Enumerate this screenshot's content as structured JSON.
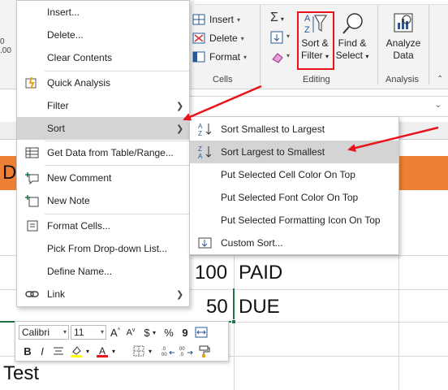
{
  "ribbon": {
    "cells_group": {
      "label": "Cells",
      "insert": "Insert",
      "delete": "Delete",
      "format": "Format"
    },
    "editing_group": {
      "label": "Editing",
      "sort_filter": "Sort &",
      "sort_filter_2": "Filter",
      "find_select": "Find &",
      "find_select_2": "Select"
    },
    "analysis_group": {
      "label": "Analysis",
      "analyze_data": "Analyze",
      "analyze_data_2": "Data"
    },
    "left_stub": {
      "top": "0",
      "bottom": ".00"
    }
  },
  "context_menu": {
    "items": [
      {
        "label": "Insert...",
        "key": "I"
      },
      {
        "label": "Delete...",
        "key": "D"
      },
      {
        "label": "Clear Contents",
        "key": "N"
      },
      {
        "label": "Quick Analysis",
        "key": "Q"
      },
      {
        "label": "Filter",
        "key": "E"
      },
      {
        "label": "Sort",
        "key": "O"
      },
      {
        "label": "Get Data from Table/Range...",
        "key": "G"
      },
      {
        "label": "New Comment",
        "key": "M"
      },
      {
        "label": "New Note",
        "key": "N"
      },
      {
        "label": "Format Cells...",
        "key": "F"
      },
      {
        "label": "Pick From Drop-down List...",
        "key": "K"
      },
      {
        "label": "Define Name...",
        "key": "A"
      },
      {
        "label": "Link",
        "key": "I"
      }
    ]
  },
  "sort_submenu": {
    "items": [
      {
        "label": "Sort Smallest to Largest"
      },
      {
        "label": "Sort Largest to Smallest"
      },
      {
        "label": "Put Selected Cell Color On Top"
      },
      {
        "label": "Put Selected Font Color On Top"
      },
      {
        "label": "Put Selected Formatting Icon On Top"
      },
      {
        "label": "Custom Sort..."
      }
    ]
  },
  "sheet": {
    "header_stub": "D",
    "row1_value": "100",
    "row1_status": "PAID",
    "row2_value": "50",
    "row2_status": "DUE",
    "bottom_text": "Test"
  },
  "mini_toolbar": {
    "font_name": "Calibri",
    "font_size": "11",
    "percent": "%",
    "comma": "9",
    "bold": "B",
    "italic": "I",
    "font_color_letter": "A"
  },
  "colors": {
    "accent_red": "#e8141a",
    "header_orange": "#ee8035",
    "highlight_gray": "#d4d4d4"
  }
}
